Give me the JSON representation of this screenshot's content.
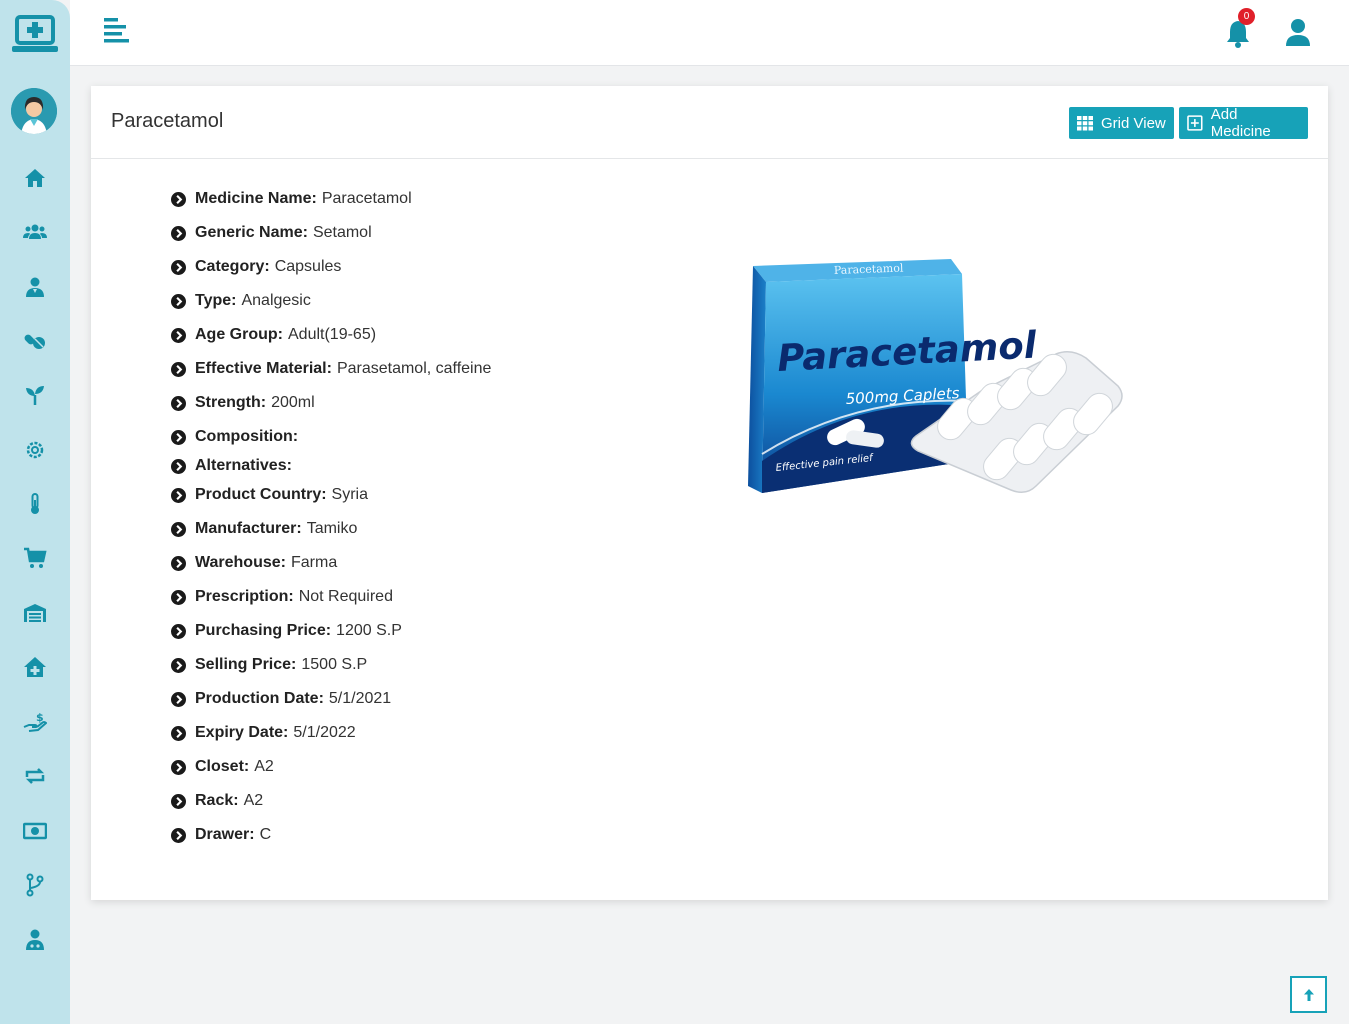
{
  "header": {
    "notification_count": "0"
  },
  "page": {
    "title": "Paracetamol"
  },
  "buttons": {
    "grid_view": "Grid View",
    "add_medicine": "Add Medicine"
  },
  "details": [
    {
      "label": "Medicine Name:",
      "value": "Paracetamol"
    },
    {
      "label": "Generic Name:",
      "value": "Setamol"
    },
    {
      "label": "Category:",
      "value": "Capsules"
    },
    {
      "label": "Type:",
      "value": "Analgesic"
    },
    {
      "label": "Age Group:",
      "value": "Adult(19-65)"
    },
    {
      "label": "Effective Material:",
      "value": "Parasetamol, caffeine"
    },
    {
      "label": "Strength:",
      "value": "200ml"
    },
    {
      "label": "Composition:",
      "value": ""
    },
    {
      "label": "Alternatives:",
      "value": ""
    },
    {
      "label": "Product Country:",
      "value": "Syria"
    },
    {
      "label": "Manufacturer:",
      "value": "Tamiko"
    },
    {
      "label": "Warehouse:",
      "value": "Farma"
    },
    {
      "label": "Prescription:",
      "value": "Not Required"
    },
    {
      "label": "Purchasing Price:",
      "value": "1200 S.P"
    },
    {
      "label": "Selling Price:",
      "value": "1500 S.P"
    },
    {
      "label": "Production Date:",
      "value": "5/1/2021"
    },
    {
      "label": "Expiry Date:",
      "value": "5/1/2022"
    },
    {
      "label": "Closet:",
      "value": "A2"
    },
    {
      "label": "Rack:",
      "value": "A2"
    },
    {
      "label": "Drawer:",
      "value": "C"
    }
  ],
  "product_image": {
    "box_brand": "Paracetamol",
    "box_sub": "500mg Caplets",
    "box_tag": "Effective pain relief",
    "box_top": "Paracetamol"
  },
  "nav_icons": [
    "home-icon",
    "patients-icon",
    "doctor-icon",
    "pills-icon",
    "seedling-icon",
    "settings-icon",
    "thermometer-icon",
    "cart-icon",
    "warehouse-icon",
    "clinic-icon",
    "payment-icon",
    "exchange-icon",
    "money-icon",
    "branch-icon",
    "staff-icon"
  ],
  "colors": {
    "accent": "#17a2b8",
    "sidebar_bg": "#bfe3eb",
    "badge": "#e0202a"
  }
}
